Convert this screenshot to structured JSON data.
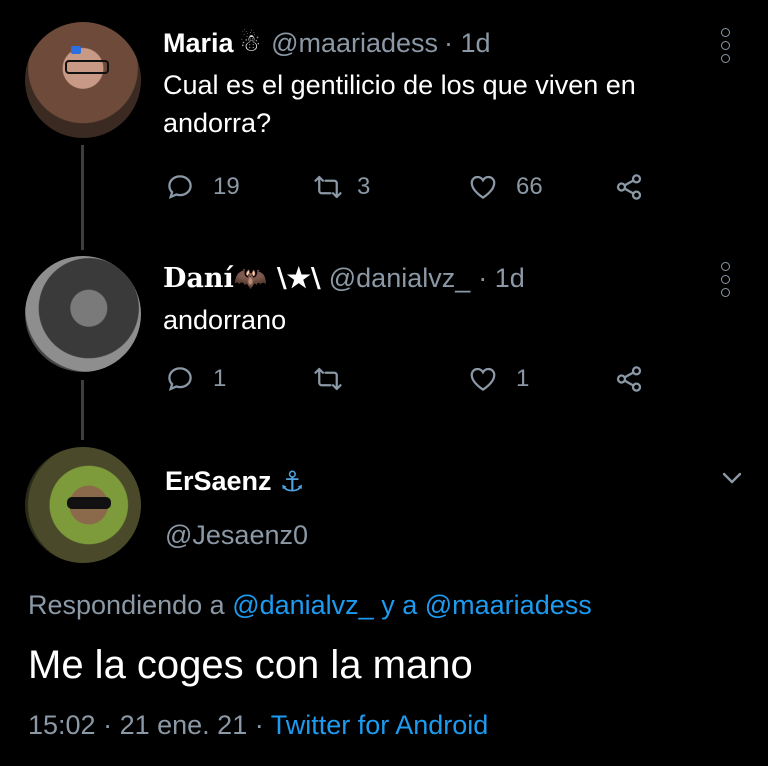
{
  "tweet1": {
    "name": "Maria",
    "name_emoji": "☃",
    "handle": "@maariadess",
    "time": "· 1d",
    "text_line1": "Cual es el gentilicio de los que viven en",
    "text_line2": "andorra?",
    "replies": "19",
    "retweets": "3",
    "likes": "66"
  },
  "tweet2": {
    "name": "Daní🦇 \\★\\",
    "handle": "@danialvz_",
    "time": "· 1d",
    "text": "andorrano",
    "replies": "1",
    "likes": "1"
  },
  "main_tweet": {
    "name": "ErSaenz",
    "name_emoji": "⚓",
    "handle": "@Jesaenz0",
    "replying_prefix": "Respondiendo a",
    "replying_user1": "@danialvz_",
    "replying_and": "y a",
    "replying_user2": "@maariadess",
    "text": "Me la coges con la mano",
    "time": "15:02",
    "date": "· 21 ene. 21 ·",
    "source": "Twitter for Android"
  },
  "colors": {
    "background": "#000000",
    "muted": "#8b98a5",
    "accent": "#1d9bf0"
  }
}
